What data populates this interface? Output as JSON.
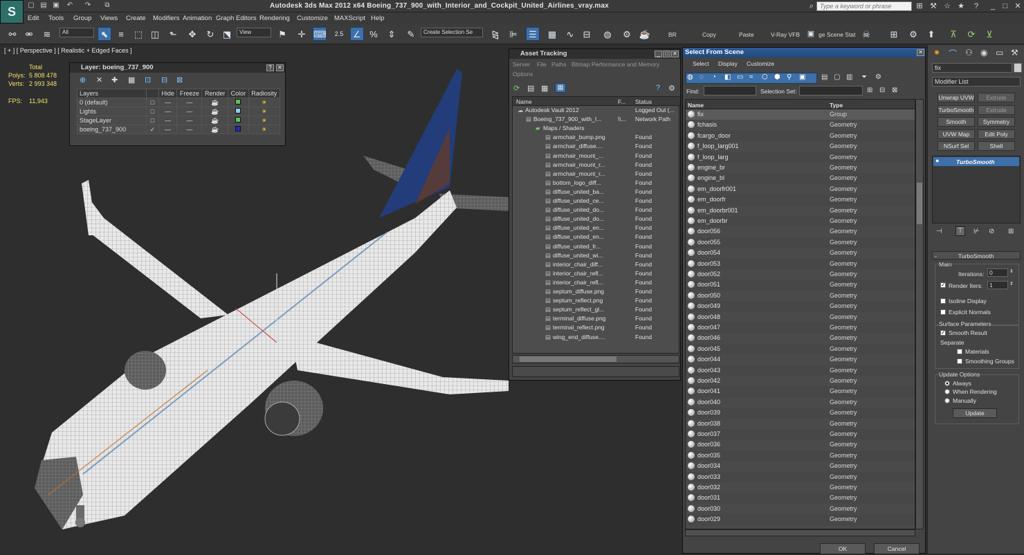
{
  "title_bar": {
    "title": "Autodesk 3ds Max  2012 x64      Boeing_737_900_with_Interior_and_Cockpit_United_Airlines_vray.max",
    "search_placeholder": "Type a keyword or phrase"
  },
  "menu": [
    "Edit",
    "Tools",
    "Group",
    "Views",
    "Create",
    "Modifiers",
    "Animation",
    "Graph Editors",
    "Rendering",
    "Customize",
    "MAXScript",
    "Help"
  ],
  "toolbar": {
    "selection_filter": "All",
    "ref_coord": "View",
    "snap_value": "2.5",
    "named_selection_placeholder": "Create Selection Se",
    "labels": [
      "BR",
      "Copy",
      "Paste",
      "V-Ray VFB",
      "ge Scene Stat"
    ]
  },
  "viewport": {
    "label": "[ + ] [ Perspective ] [ Realistic + Edged Faces ]",
    "stats": {
      "total_label": "Total",
      "polys_label": "Polys:",
      "polys": "5 808 478",
      "verts_label": "Verts:",
      "verts": "2 993 348",
      "fps_label": "FPS:",
      "fps": "11,943"
    }
  },
  "layer_dialog": {
    "title": "Layer: boeing_737_900",
    "columns": [
      "Layers",
      "Hide",
      "Freeze",
      "Render",
      "Color",
      "Radiosity"
    ],
    "rows": [
      {
        "name": "0 (default)",
        "color": "#5fc05f"
      },
      {
        "name": "Lights",
        "color": "#88d4e6"
      },
      {
        "name": "StageLayer",
        "color": "#5fc05f"
      },
      {
        "name": "boeing_737_900",
        "color": "#2a2ab5"
      }
    ]
  },
  "asset_tracking": {
    "title": "Asset Tracking",
    "menu": [
      "Server",
      "File",
      "Paths",
      "Bitmap Performance and Memory",
      "Options"
    ],
    "columns": [
      "Name",
      "F...",
      "Status"
    ],
    "rows": [
      {
        "name": "Autodesk Vault 2012",
        "f": "",
        "status": "Logged Out (..."
      },
      {
        "name": "Boeing_737_900_with_I...",
        "f": "\\\\...",
        "status": "Network Path"
      },
      {
        "name": "Maps / Shaders",
        "f": "",
        "status": ""
      },
      {
        "name": "armchair_bump.png",
        "f": "",
        "status": "Found"
      },
      {
        "name": "armchair_diffuse....",
        "f": "",
        "status": "Found"
      },
      {
        "name": "armchair_mount_...",
        "f": "",
        "status": "Found"
      },
      {
        "name": "armchair_mount_r...",
        "f": "",
        "status": "Found"
      },
      {
        "name": "armchair_mount_r...",
        "f": "",
        "status": "Found"
      },
      {
        "name": "bottom_logo_diff...",
        "f": "",
        "status": "Found"
      },
      {
        "name": "diffuse_united_ba...",
        "f": "",
        "status": "Found"
      },
      {
        "name": "diffuse_united_ce...",
        "f": "",
        "status": "Found"
      },
      {
        "name": "diffuse_united_do...",
        "f": "",
        "status": "Found"
      },
      {
        "name": "diffuse_united_do...",
        "f": "",
        "status": "Found"
      },
      {
        "name": "diffuse_united_en...",
        "f": "",
        "status": "Found"
      },
      {
        "name": "diffuse_united_en...",
        "f": "",
        "status": "Found"
      },
      {
        "name": "diffuse_united_fr...",
        "f": "",
        "status": "Found"
      },
      {
        "name": "diffuse_united_wi...",
        "f": "",
        "status": "Found"
      },
      {
        "name": "interior_chair_diff...",
        "f": "",
        "status": "Found"
      },
      {
        "name": "interior_chair_refl...",
        "f": "",
        "status": "Found"
      },
      {
        "name": "interior_chair_refl...",
        "f": "",
        "status": "Found"
      },
      {
        "name": "septum_diffuse.png",
        "f": "",
        "status": "Found"
      },
      {
        "name": "septum_reflect.png",
        "f": "",
        "status": "Found"
      },
      {
        "name": "septum_reflect_gl...",
        "f": "",
        "status": "Found"
      },
      {
        "name": "terminal_diffuse.png",
        "f": "",
        "status": "Found"
      },
      {
        "name": "terminal_reflect.png",
        "f": "",
        "status": "Found"
      },
      {
        "name": "wing_end_diffuse....",
        "f": "",
        "status": "Found"
      }
    ]
  },
  "select_from_scene": {
    "title": "Select From Scene",
    "menu": [
      "Select",
      "Display",
      "Customize"
    ],
    "find_label": "Find:",
    "selection_set_label": "Selection Set:",
    "columns": [
      "Name",
      "Type"
    ],
    "rows": [
      {
        "name": "fix",
        "type": "Group"
      },
      {
        "name": "fchasis",
        "type": "Geometry"
      },
      {
        "name": "fcargo_door",
        "type": "Geometry"
      },
      {
        "name": "f_loop_larg001",
        "type": "Geometry"
      },
      {
        "name": "f_loop_larg",
        "type": "Geometry"
      },
      {
        "name": "engine_br",
        "type": "Geometry"
      },
      {
        "name": "engine_bl",
        "type": "Geometry"
      },
      {
        "name": "em_doorfr001",
        "type": "Geometry"
      },
      {
        "name": "em_doorfr",
        "type": "Geometry"
      },
      {
        "name": "em_doorbr001",
        "type": "Geometry"
      },
      {
        "name": "em_doorbr",
        "type": "Geometry"
      },
      {
        "name": "door056",
        "type": "Geometry"
      },
      {
        "name": "door055",
        "type": "Geometry"
      },
      {
        "name": "door054",
        "type": "Geometry"
      },
      {
        "name": "door053",
        "type": "Geometry"
      },
      {
        "name": "door052",
        "type": "Geometry"
      },
      {
        "name": "door051",
        "type": "Geometry"
      },
      {
        "name": "door050",
        "type": "Geometry"
      },
      {
        "name": "door049",
        "type": "Geometry"
      },
      {
        "name": "door048",
        "type": "Geometry"
      },
      {
        "name": "door047",
        "type": "Geometry"
      },
      {
        "name": "door046",
        "type": "Geometry"
      },
      {
        "name": "door045",
        "type": "Geometry"
      },
      {
        "name": "door044",
        "type": "Geometry"
      },
      {
        "name": "door043",
        "type": "Geometry"
      },
      {
        "name": "door042",
        "type": "Geometry"
      },
      {
        "name": "door041",
        "type": "Geometry"
      },
      {
        "name": "door040",
        "type": "Geometry"
      },
      {
        "name": "door039",
        "type": "Geometry"
      },
      {
        "name": "door038",
        "type": "Geometry"
      },
      {
        "name": "door037",
        "type": "Geometry"
      },
      {
        "name": "door036",
        "type": "Geometry"
      },
      {
        "name": "door035",
        "type": "Geometry"
      },
      {
        "name": "door034",
        "type": "Geometry"
      },
      {
        "name": "door033",
        "type": "Geometry"
      },
      {
        "name": "door032",
        "type": "Geometry"
      },
      {
        "name": "door031",
        "type": "Geometry"
      },
      {
        "name": "door030",
        "type": "Geometry"
      },
      {
        "name": "door029",
        "type": "Geometry"
      }
    ],
    "ok": "OK",
    "cancel": "Cancel"
  },
  "command_panel": {
    "object_name": "fix",
    "modifier_list": "Modifier List",
    "buttons": [
      "Unwrap UVW",
      "Extrude",
      "TurboSmooth",
      "Extrude",
      "Smooth",
      "Symmetry",
      "UVW Map",
      "Edit Poly",
      "NSurf Sel",
      "Shell"
    ],
    "stack_item": "TurboSmooth",
    "rollout_title": "TurboSmooth",
    "main_label": "Main",
    "iterations_label": "Iterations:",
    "iterations": "0",
    "render_iters_label": "Render Iters:",
    "render_iters": "1",
    "isoline": "Isoline Display",
    "explicit": "Explicit Normals",
    "surface_params": "Surface Parameters",
    "smooth_result": "Smooth Result",
    "separate": "Separate",
    "materials": "Materials",
    "smoothing_groups": "Smoothing Groups",
    "update_options": "Update Options",
    "always": "Always",
    "when_rendering": "When Rendering",
    "manually": "Manually",
    "update": "Update"
  }
}
